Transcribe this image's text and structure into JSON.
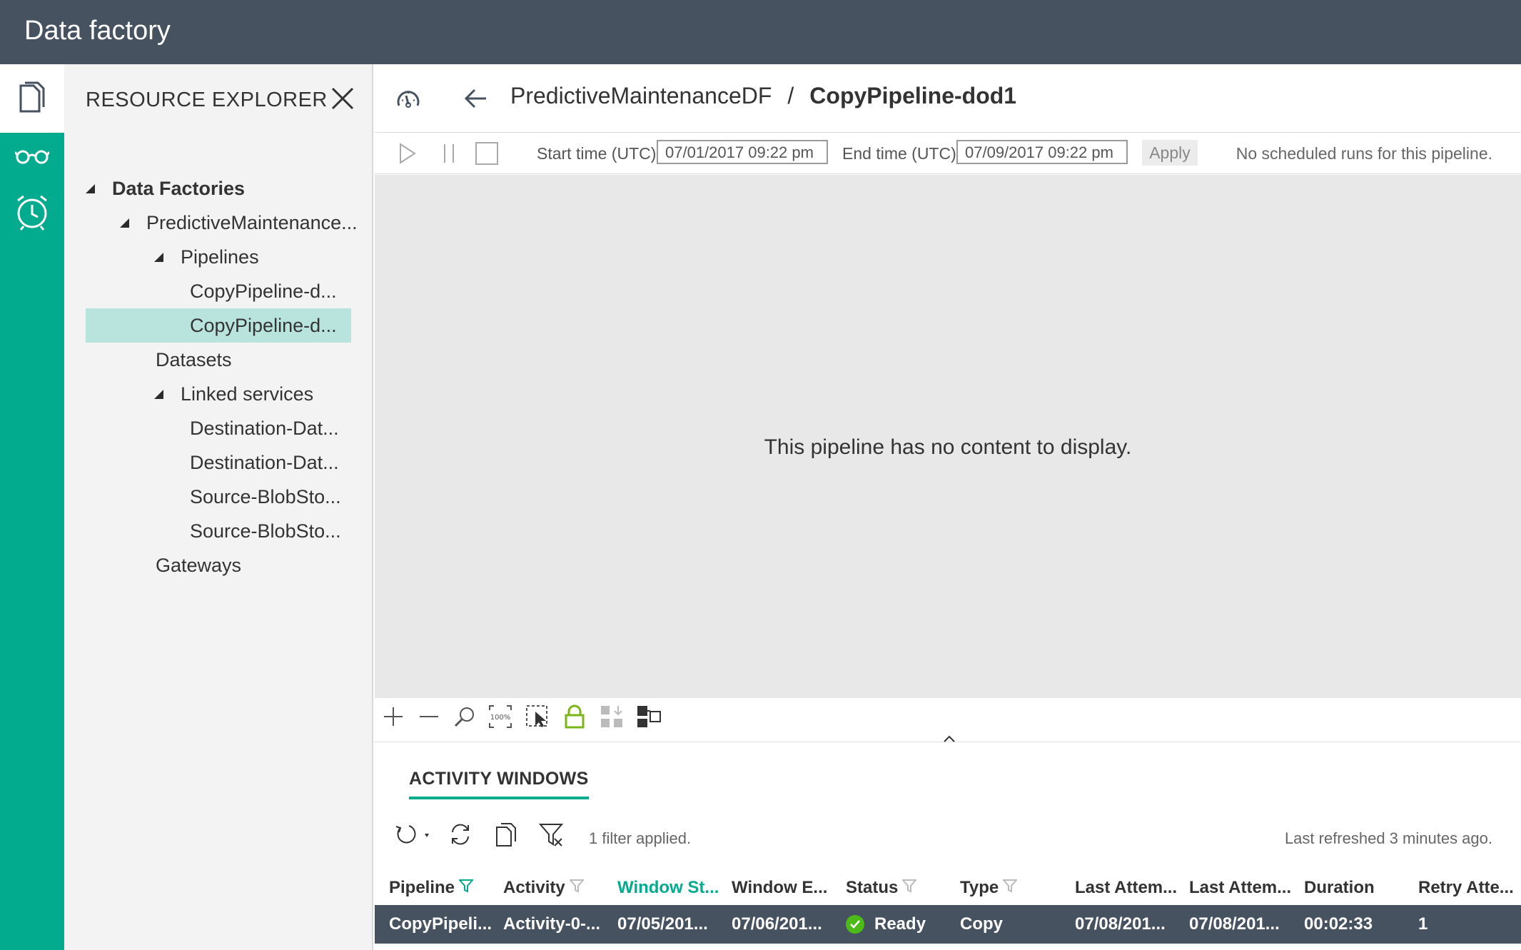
{
  "app": {
    "title": "Data factory"
  },
  "rail": {
    "items": [
      "documents-icon",
      "glasses-icon",
      "alarm-clock-icon"
    ]
  },
  "explorer": {
    "title": "RESOURCE EXPLORER",
    "tree": [
      {
        "label": "Data Factories",
        "level": 0,
        "expanded": true,
        "bold": true
      },
      {
        "label": "PredictiveMaintenance...",
        "level": 1,
        "expanded": true
      },
      {
        "label": "Pipelines",
        "level": 2,
        "expanded": true
      },
      {
        "label": "CopyPipeline-d...",
        "level": 3
      },
      {
        "label": "CopyPipeline-d...",
        "level": 3,
        "selected": true
      },
      {
        "label": "Datasets",
        "level": 2
      },
      {
        "label": "Linked services",
        "level": 2,
        "expanded": true
      },
      {
        "label": "Destination-Dat...",
        "level": 3
      },
      {
        "label": "Destination-Dat...",
        "level": 3
      },
      {
        "label": "Source-BlobSto...",
        "level": 3
      },
      {
        "label": "Source-BlobSto...",
        "level": 3
      },
      {
        "label": "Gateways",
        "level": 2
      }
    ]
  },
  "header": {
    "factory": "PredictiveMaintenanceDF",
    "separator": "/",
    "pipeline": "CopyPipeline-dod1"
  },
  "toolbar": {
    "start_label": "Start time (UTC):",
    "start_value": "07/01/2017 09:22 pm",
    "end_label": "End time (UTC):",
    "end_value": "07/09/2017 09:22 pm",
    "apply_label": "Apply",
    "message": "No scheduled runs for this pipeline."
  },
  "canvas": {
    "empty_message": "This pipeline has no content to display."
  },
  "activity_windows": {
    "tab_label": "ACTIVITY WINDOWS",
    "filter_message": "1 filter applied.",
    "refresh_message": "Last refreshed 3 minutes ago.",
    "columns": [
      "Pipeline",
      "Activity",
      "Window St...",
      "Window E...",
      "Status",
      "Type",
      "Last Attem...",
      "Last Attem...",
      "Duration",
      "Retry Atte..."
    ],
    "rows": [
      [
        "CopyPipeli...",
        "Activity-0-...",
        "07/05/201...",
        "07/06/201...",
        "Ready",
        "Copy",
        "07/08/201...",
        "07/08/201...",
        "00:02:33",
        "1"
      ]
    ]
  },
  "colors": {
    "accent": "#02ab8e",
    "titlebar": "#475260",
    "selected": "#b9e3dd",
    "status_ok": "#4cbb17"
  }
}
